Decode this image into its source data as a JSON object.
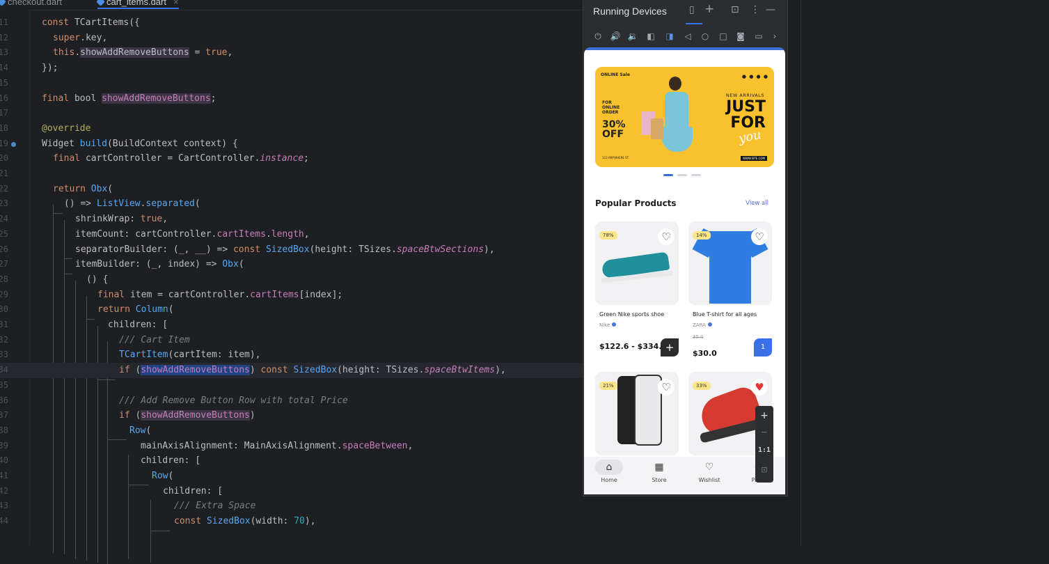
{
  "editor": {
    "tabs": [
      {
        "label": "checkout.dart",
        "active": false
      },
      {
        "label": "cart_items.dart",
        "active": true
      }
    ],
    "close_glyph": "×"
  },
  "panel": {
    "title": "Running Devices",
    "icons": [
      "device-icon",
      "add-icon",
      "layout-icon",
      "more-icon",
      "minimize-icon"
    ],
    "toolbar_icons": [
      "power-icon",
      "volume-up-icon",
      "volume-down-icon",
      "rotate-left-icon",
      "rotate-right-icon",
      "back-icon",
      "home-icon",
      "overview-icon",
      "camera-icon",
      "record-icon",
      "chevron-right-icon"
    ]
  },
  "app": {
    "banner": {
      "logo": "ONLINE Sale",
      "for_online_order": "FOR ONLINE ORDER",
      "discount": "30% OFF",
      "new_arrivals": "NEW ARRIVALS",
      "headline": "JUST FOR",
      "script": "you",
      "address": "123 ANYWHERE ST.",
      "website": "WWW.SITE.COM"
    },
    "section_title": "Popular Products",
    "view_all": "View all",
    "products": [
      {
        "badge": "78%",
        "name": "Green Nike sports shoe",
        "brand": "Nike",
        "price": "$122.6 - $334.0",
        "old_price": "",
        "button": "+",
        "wishlisted": false
      },
      {
        "badge": "14%",
        "name": "Blue T-shirt for all ages",
        "brand": "ZARA",
        "price": "$30.0",
        "old_price": "35.0",
        "button": "1",
        "wishlisted": false
      },
      {
        "badge": "21%",
        "name": "",
        "brand": "",
        "price": "",
        "old_price": "",
        "button": "",
        "wishlisted": false
      },
      {
        "badge": "33%",
        "name": "",
        "brand": "",
        "price": "",
        "old_price": "",
        "button": "",
        "wishlisted": true
      }
    ],
    "nav": [
      "Home",
      "Store",
      "Wishlist",
      "Profile"
    ],
    "zoom": {
      "plus": "+",
      "minus": "−",
      "ratio": "1:1"
    }
  },
  "colors": {
    "editor_bg": "#1e1f22",
    "keyword": "#cf8e6d",
    "function": "#56a8f5",
    "property": "#c77dbb",
    "number": "#2aacb8",
    "banner_yellow": "#f9c12e",
    "accent_blue": "#3a6fe8"
  }
}
